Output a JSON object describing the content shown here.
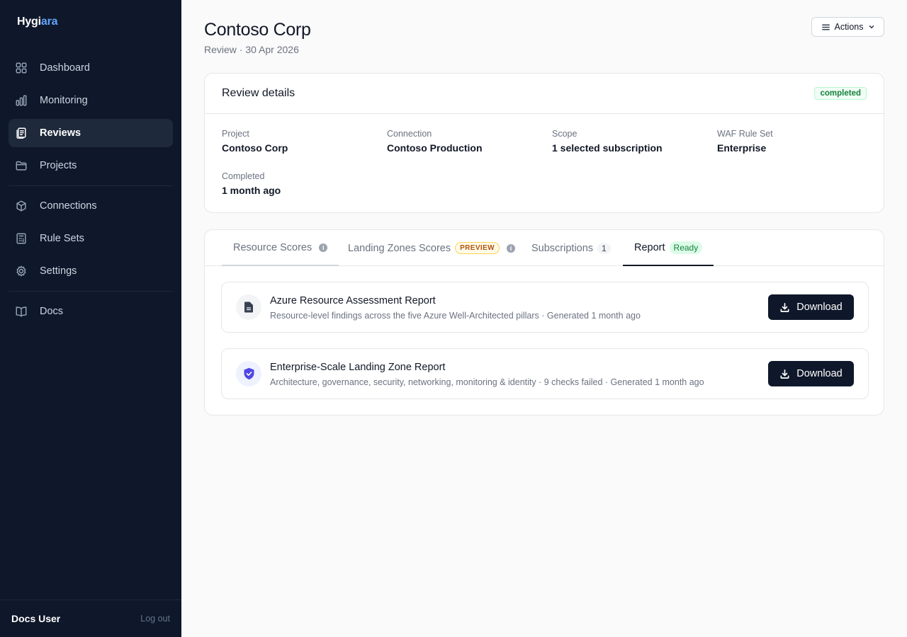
{
  "app": {
    "brand_prefix": "Hygi",
    "brand_suffix": "ara"
  },
  "sidebar": {
    "items": [
      {
        "label": "Dashboard",
        "icon": "grid-icon"
      },
      {
        "label": "Monitoring",
        "icon": "bar-chart-icon"
      },
      {
        "label": "Reviews",
        "icon": "clipboard-icon",
        "active": true
      },
      {
        "label": "Projects",
        "icon": "folder-icon"
      },
      {
        "label": "Connections",
        "icon": "cube-icon"
      },
      {
        "label": "Rule Sets",
        "icon": "calculator-icon"
      },
      {
        "label": "Settings",
        "icon": "gear-icon"
      },
      {
        "label": "Docs",
        "icon": "book-icon"
      }
    ],
    "user": "Docs User",
    "logout": "Log out"
  },
  "header": {
    "title": "Contoso Corp",
    "subtitle": "Review · 30 Apr 2026",
    "actions_label": "Actions"
  },
  "details": {
    "title": "Review details",
    "status": "completed",
    "status_color": "#15803d",
    "fields": [
      {
        "label": "Project",
        "value": "Contoso Corp"
      },
      {
        "label": "Connection",
        "value": "Contoso Production"
      },
      {
        "label": "Scope",
        "value": "1 selected subscription"
      },
      {
        "label": "WAF Rule Set",
        "value": "Enterprise"
      },
      {
        "label": "Completed",
        "value": "1 month ago"
      }
    ]
  },
  "tabs": [
    {
      "label": "Resource Scores"
    },
    {
      "label": "Landing Zones Scores",
      "badge": "PREVIEW"
    },
    {
      "label": "Subscriptions",
      "badge": "1"
    },
    {
      "label": "Report",
      "badge": "Ready",
      "active": true
    }
  ],
  "reports": [
    {
      "title": "Azure Resource Assessment Report",
      "description": "Resource-level findings across the five Azure Well-Architected pillars · Generated 1 month ago",
      "icon": "document-icon",
      "button": "Download"
    },
    {
      "title": "Enterprise-Scale Landing Zone Report",
      "description": "Architecture, governance, security, networking, monitoring & identity · 9 checks failed · Generated 1 month ago",
      "icon": "shield-check-icon",
      "button": "Download"
    }
  ],
  "colors": {
    "sidebar_bg": "#0f172a",
    "accent": "#60a5fa",
    "primary_button": "#0f172a",
    "shield": "#4f46e5"
  }
}
